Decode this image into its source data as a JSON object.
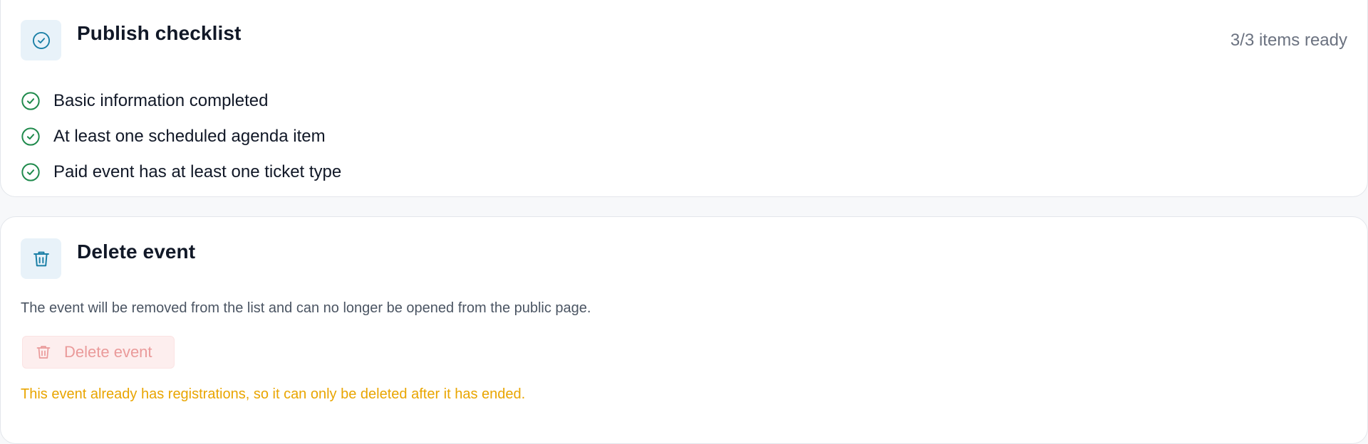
{
  "colors": {
    "accent": "#1a7fa6",
    "success": "#1f8a4c",
    "danger_muted": "#ea9a9a",
    "warning": "#e9a500",
    "muted_text": "#6b7280"
  },
  "checklist": {
    "icon": "check-circle-icon",
    "title": "Publish checklist",
    "ready_count": "3/3 items ready",
    "items": [
      {
        "label": "Basic information completed",
        "icon": "check-circle-icon",
        "done": true
      },
      {
        "label": "At least one scheduled agenda item",
        "icon": "check-circle-icon",
        "done": true
      },
      {
        "label": "Paid event has at least one ticket type",
        "icon": "check-circle-icon",
        "done": true
      }
    ]
  },
  "delete_section": {
    "icon": "trash-icon",
    "title": "Delete event",
    "description": "The event will be removed from the list and can no longer be opened from the public page.",
    "button_label": "Delete event",
    "button_icon": "trash-icon",
    "button_disabled": true,
    "warning": "This event already has registrations, so it can only be deleted after it has ended."
  }
}
